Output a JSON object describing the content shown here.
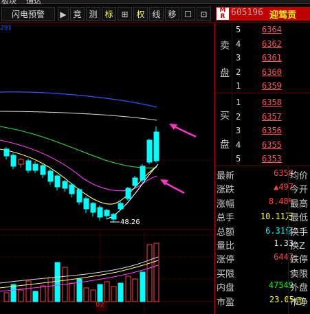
{
  "top_strip": {
    "left_text": "板块",
    "right_text": "通达"
  },
  "toolbar": {
    "alert_label": "闪电预警",
    "buttons": [
      {
        "label": "▶",
        "active": false
      },
      {
        "label": "竞",
        "active": false
      },
      {
        "label": "测",
        "active": false
      },
      {
        "label": "标",
        "active": true
      },
      {
        "label": "⊞",
        "active": false
      },
      {
        "label": "权",
        "active": true
      },
      {
        "label": "线",
        "active": false
      },
      {
        "label": "移",
        "active": false
      },
      {
        "label": "☐",
        "active": false
      },
      {
        "label": "⊡",
        "active": false
      }
    ]
  },
  "stock": {
    "logo_text": "M\nR",
    "code": "605196",
    "name": "迎驾贡"
  },
  "chart": {
    "value_label": "291",
    "low_label": "48.26",
    "date_label": "02"
  },
  "sell": {
    "side_label": [
      "卖",
      "盘"
    ],
    "levels": [
      {
        "level": "5",
        "price": "6364"
      },
      {
        "level": "4",
        "price": "6362"
      },
      {
        "level": "3",
        "price": "6361"
      },
      {
        "level": "2",
        "price": "6360"
      },
      {
        "level": "1",
        "price": "6359"
      }
    ]
  },
  "buy": {
    "side_label": [
      "买",
      "盘"
    ],
    "levels": [
      {
        "level": "1",
        "price": "6358"
      },
      {
        "level": "2",
        "price": "6357"
      },
      {
        "level": "3",
        "price": "6356"
      },
      {
        "level": "4",
        "price": "6355"
      },
      {
        "level": "5",
        "price": "6353"
      }
    ]
  },
  "quote": [
    {
      "label": "最新",
      "value": "6358",
      "color": "red",
      "label2": "均价"
    },
    {
      "label": "涨跌",
      "value": "▲497",
      "color": "red",
      "label2": "今开"
    },
    {
      "label": "涨幅",
      "value": "8.48%",
      "color": "red",
      "label2": "最高"
    },
    {
      "label": "总手",
      "value": "10.11万",
      "color": "yellow",
      "label2": "最低"
    },
    {
      "label": "总额",
      "value": "6.31亿",
      "color": "cyan",
      "label2": "换手"
    },
    {
      "label": "量比",
      "value": "1.33",
      "color": "white",
      "label2": "换Z"
    },
    {
      "label": "涨停",
      "value": "6447",
      "color": "red",
      "label2": "跌停"
    },
    {
      "label": "买限",
      "value": "-",
      "color": "white",
      "label2": "卖限"
    },
    {
      "label": "内盘",
      "value": "47549",
      "color": "green",
      "label2": "外盘"
    },
    {
      "label": "市盈",
      "value": "23.05",
      "color": "yellow",
      "label2": "市净"
    }
  ],
  "quote_badge": "3",
  "colors": {
    "up": "#ff4444",
    "down": "#00ffff",
    "ma_white": "#dddddd",
    "ma_yellow": "#ffff66",
    "ma_green": "#33dd33",
    "ma_magenta": "#ff44ff",
    "ma_blue": "#3355ff",
    "arrow": "#ff33cc"
  }
}
